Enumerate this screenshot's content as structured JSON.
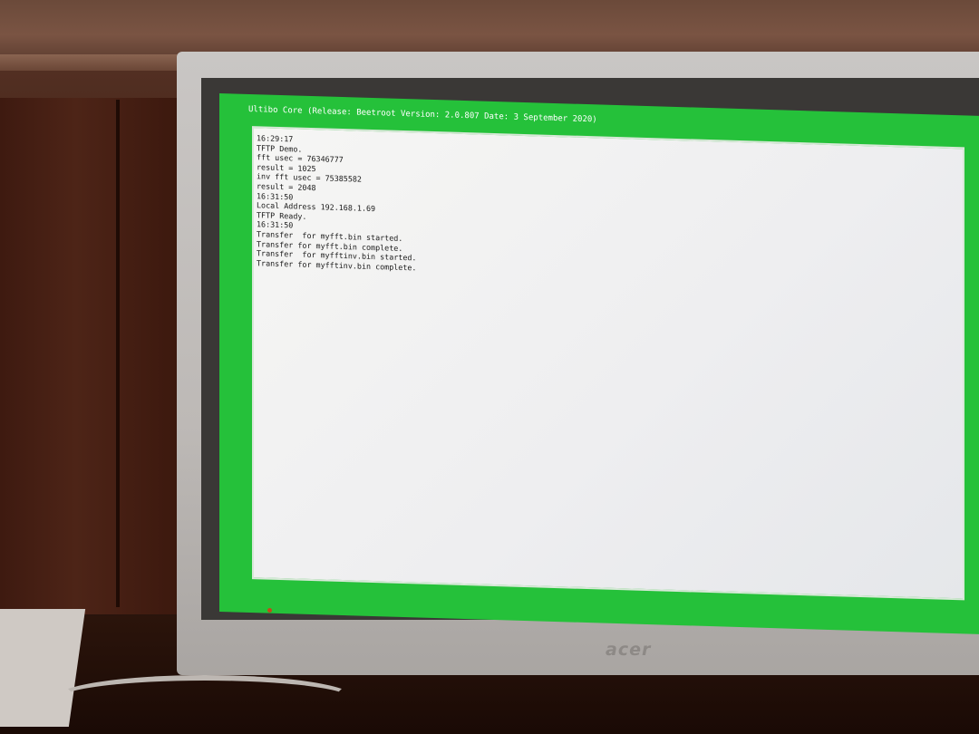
{
  "screen": {
    "title": "Ultibo Core (Release: Beetroot Version: 2.0.807 Date: 3 September 2020)",
    "console_lines": [
      "16:29:17",
      "TFTP Demo.",
      "fft usec = 76346777",
      "result = 1025",
      "inv fft usec = 75385582",
      "result = 2048",
      "16:31:50",
      "Local Address 192.168.1.69",
      "TFTP Ready.",
      "16:31:50",
      "Transfer  for myfft.bin started.",
      "Transfer for myfft.bin complete.",
      "Transfer  for myfftinv.bin started.",
      "Transfer for myfftinv.bin complete."
    ]
  },
  "monitor": {
    "brand": "acer"
  },
  "colors": {
    "screen_border": "#25c13a",
    "console_background": "#f2f2f2",
    "text": "#1a1a1a"
  }
}
